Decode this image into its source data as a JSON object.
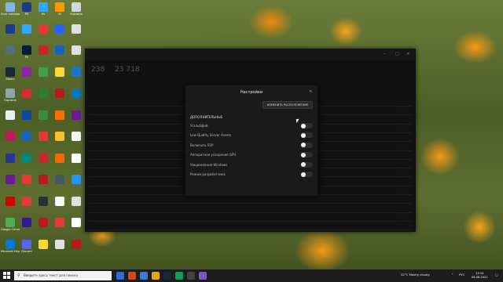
{
  "desktop": {
    "icons": [
      {
        "label": "Этот компьютер",
        "color": "#7fb6e8"
      },
      {
        "label": "PS",
        "color": "#1e3a8a"
      },
      {
        "label": "Ps",
        "color": "#31a8ff"
      },
      {
        "label": "Ai",
        "color": "#ff9a00"
      },
      {
        "label": "Корзина",
        "color": "#cfd8dc"
      },
      {
        "label": "",
        "color": "#1e3a8a"
      },
      {
        "label": "",
        "color": "#31a8ff"
      },
      {
        "label": "",
        "color": "#e53935"
      },
      {
        "label": "",
        "color": "#2962ff"
      },
      {
        "label": "",
        "color": "#e0e0e0"
      },
      {
        "label": "",
        "color": "#546e7a"
      },
      {
        "label": "Ps",
        "color": "#001e36"
      },
      {
        "label": "",
        "color": "#c62828"
      },
      {
        "label": "",
        "color": "#1565c0"
      },
      {
        "label": "",
        "color": "#e0e0e0"
      },
      {
        "label": "Steam",
        "color": "#1b2838"
      },
      {
        "label": "",
        "color": "#8e24aa"
      },
      {
        "label": "",
        "color": "#43a047"
      },
      {
        "label": "",
        "color": "#fdd835"
      },
      {
        "label": "",
        "color": "#1976d2"
      },
      {
        "label": "Корзина",
        "color": "#90a4ae"
      },
      {
        "label": "",
        "color": "#d32f2f"
      },
      {
        "label": "",
        "color": "#2e7d32"
      },
      {
        "label": "",
        "color": "#b71c1c"
      },
      {
        "label": "",
        "color": "#0277bd"
      },
      {
        "label": "",
        "color": "#eceff1"
      },
      {
        "label": "",
        "color": "#0d47a1"
      },
      {
        "label": "",
        "color": "#388e3c"
      },
      {
        "label": "",
        "color": "#ff6f00"
      },
      {
        "label": "",
        "color": "#6a1b9a"
      },
      {
        "label": "",
        "color": "#c2185b"
      },
      {
        "label": "",
        "color": "#1565c0"
      },
      {
        "label": "",
        "color": "#e53935"
      },
      {
        "label": "",
        "color": "#fbc02d"
      },
      {
        "label": "",
        "color": "#f5f5f5"
      },
      {
        "label": "",
        "color": "#283593"
      },
      {
        "label": "",
        "color": "#00897b"
      },
      {
        "label": "",
        "color": "#c62828"
      },
      {
        "label": "",
        "color": "#ef6c00"
      },
      {
        "label": "",
        "color": "#ffffff"
      },
      {
        "label": "",
        "color": "#6a1b9a"
      },
      {
        "label": "",
        "color": "#e53935"
      },
      {
        "label": "",
        "color": "#b71c1c"
      },
      {
        "label": "",
        "color": "#455a64"
      },
      {
        "label": "",
        "color": "#2196f3"
      },
      {
        "label": "",
        "color": "#d50000"
      },
      {
        "label": "",
        "color": "#e53935"
      },
      {
        "label": "",
        "color": "#263238"
      },
      {
        "label": "",
        "color": "#fafafa"
      },
      {
        "label": "",
        "color": "#e0e0e0"
      },
      {
        "label": "Google Chrome",
        "color": "#4caf50"
      },
      {
        "label": "",
        "color": "#311b92"
      },
      {
        "label": "",
        "color": "#b71c1c"
      },
      {
        "label": "",
        "color": "#e53935"
      },
      {
        "label": "",
        "color": "#ffffff"
      },
      {
        "label": "Microsoft Edge",
        "color": "#0078d7"
      },
      {
        "label": "Discord",
        "color": "#5865f2"
      },
      {
        "label": "",
        "color": "#fdd835"
      },
      {
        "label": "",
        "color": "#e0e0e0"
      },
      {
        "label": "",
        "color": "#b71c1c"
      }
    ]
  },
  "app": {
    "nav": [
      "",
      "",
      ""
    ],
    "stats": [
      "238",
      "23 718"
    ],
    "headers": [
      "",
      "",
      "",
      ""
    ],
    "rows": [
      {
        "name": "",
        "tag": "",
        "num": ""
      },
      {
        "name": "",
        "tag": "",
        "num": ""
      },
      {
        "name": "",
        "tag": "",
        "num": ""
      },
      {
        "name": "",
        "tag": "",
        "num": ""
      },
      {
        "name": "",
        "tag": "",
        "num": ""
      },
      {
        "name": "",
        "tag": "",
        "num": ""
      },
      {
        "name": "",
        "tag": "",
        "num": ""
      },
      {
        "name": "",
        "tag": "",
        "num": ""
      },
      {
        "name": "",
        "tag": "",
        "num": ""
      },
      {
        "name": "",
        "tag": "",
        "num": ""
      },
      {
        "name": "",
        "tag": "",
        "num": ""
      },
      {
        "name": "",
        "tag": "",
        "num": ""
      },
      {
        "name": "",
        "tag": "",
        "num": ""
      },
      {
        "name": "",
        "tag": "",
        "num": ""
      },
      {
        "name": "",
        "tag": "",
        "num": ""
      }
    ]
  },
  "modal": {
    "title": "Настройки",
    "close": "×",
    "relocate_button": "ИЗМЕНИТЬ РАСПОЛОЖЕНИЕ",
    "section": "ДОПОЛНИТЕЛЬНЫЕ",
    "options": [
      {
        "label": "Я альбфий",
        "on": false
      },
      {
        "label": "Low Quality Server Assets",
        "on": false
      },
      {
        "label": "Включить P2P",
        "on": false
      },
      {
        "label": "Аппаратное ускорение GPU",
        "on": false
      },
      {
        "label": "Уведомления Windows",
        "on": false
      },
      {
        "label": "Режим разработчика",
        "on": false
      }
    ],
    "footer": ""
  },
  "taskbar": {
    "search_placeholder": "Введите здесь текст для поиска",
    "apps": [
      {
        "color": "#2b6fd6"
      },
      {
        "color": "#d14a1e"
      },
      {
        "color": "#3a7bd5"
      },
      {
        "color": "#e8a317"
      },
      {
        "color": "#1b2838"
      },
      {
        "color": "#0f9d58"
      },
      {
        "color": "#444444"
      },
      {
        "color": "#7e57c2"
      }
    ],
    "weather": "22°C Mostly cloudy",
    "lang": "РУС",
    "time": "13:14",
    "date": "06.06.2021"
  }
}
